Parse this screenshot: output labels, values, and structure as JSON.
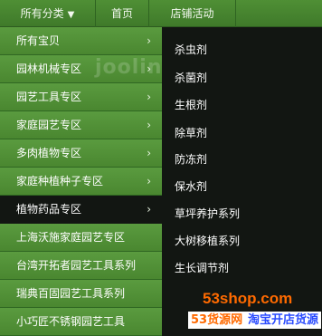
{
  "topnav": {
    "category_label": "所有分类",
    "category_caret": "▼",
    "home_label": "首页",
    "store_events_label": "店铺活动"
  },
  "left_menu": {
    "items": [
      {
        "label": "所有宝贝",
        "arrow": "›"
      },
      {
        "label": "园林机械专区",
        "arrow": "›"
      },
      {
        "label": "园艺工具专区",
        "arrow": "›"
      },
      {
        "label": "家庭园艺专区",
        "arrow": "›"
      },
      {
        "label": "多肉植物专区",
        "arrow": "›"
      },
      {
        "label": "家庭种植种子专区",
        "arrow": "›"
      },
      {
        "label": "植物药品专区",
        "arrow": "›"
      },
      {
        "label": "上海沃施家庭园艺专区",
        "arrow": ""
      },
      {
        "label": "台湾开拓者园艺工具系列",
        "arrow": ""
      },
      {
        "label": "瑞典百固园艺工具系列",
        "arrow": ""
      },
      {
        "label": "小巧匠不锈钢园艺工具",
        "arrow": ""
      }
    ]
  },
  "watermark": "jooline",
  "submenu": {
    "items": [
      "杀虫剂",
      "杀菌剂",
      "生根剂",
      "除草剂",
      "防冻剂",
      "保水剂",
      "草坪养护系列",
      "大树移植系列",
      "生长调节剂"
    ]
  },
  "brand": {
    "site": "53shop.com",
    "cn_left": "53货源网",
    "cn_right": "淘宝开店货源"
  },
  "colors": {
    "menu_green": "#4f8e34",
    "submenu_bg": "#121612",
    "brand_orange": "#ff6a00",
    "brand_blue": "#2b4cff"
  }
}
